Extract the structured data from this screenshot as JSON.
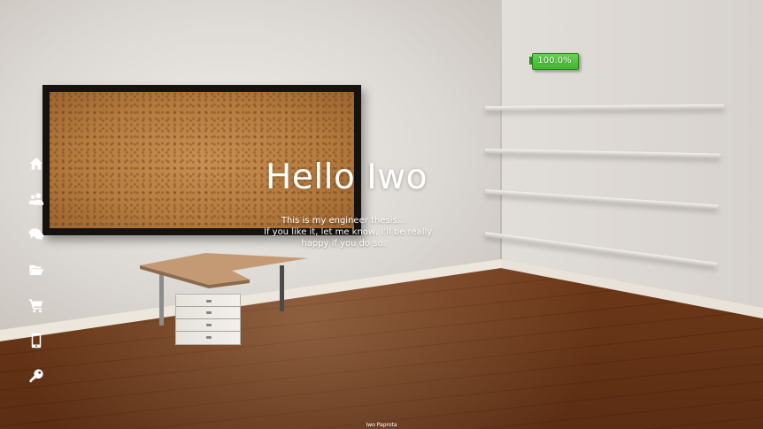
{
  "battery": {
    "label": "100.0%",
    "level_percent": 100,
    "color": "#3fb52e"
  },
  "hero": {
    "title": "Hello Iwo",
    "lines": [
      "This is my engineer thesis...",
      "If you like it, let me know, I'll be really",
      "happy if you do so."
    ]
  },
  "sidebar": {
    "items": [
      {
        "icon": "home-icon"
      },
      {
        "icon": "users-icon"
      },
      {
        "icon": "chat-icon"
      },
      {
        "icon": "folder-open-icon"
      },
      {
        "icon": "shopping-cart-icon"
      },
      {
        "icon": "mobile-phone-icon"
      },
      {
        "icon": "key-icon"
      }
    ]
  },
  "footer": {
    "author": "Iwo Paprota"
  }
}
